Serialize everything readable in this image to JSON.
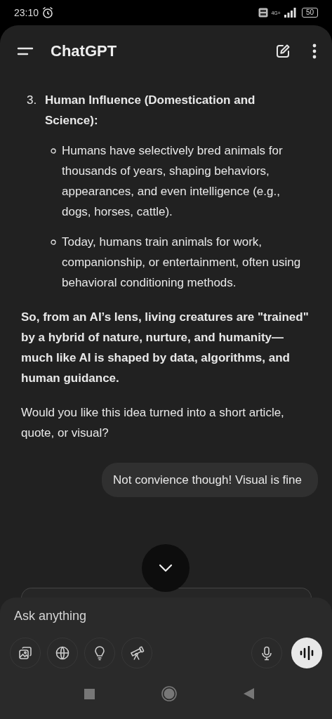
{
  "status_bar": {
    "time": "23:10",
    "network": "4G+",
    "battery": "50"
  },
  "header": {
    "title": "ChatGPT"
  },
  "assistant_message": {
    "list_item": {
      "number": "3.",
      "title": "Human Influence (Domestication and Science):",
      "bullets": [
        "Humans have selectively bred animals for thousands of years, shaping behaviors, appearances, and even intelligence (e.g., dogs, horses, cattle).",
        "Today, humans train animals for work, companionship, or entertainment, often using behavioral conditioning methods."
      ]
    },
    "summary": "So, from an AI’s lens, living creatures are \"trained\" by a hybrid of nature, nurture, and humanity—much like AI is shaped by data, algorithms, and human guidance.",
    "question": "Would you like this idea turned into a short article, quote, or visual?"
  },
  "user_message": "Not convience though! Visual is fine",
  "composer": {
    "placeholder": "Ask anything",
    "tools": [
      {
        "kind": "image"
      },
      {
        "kind": "globe"
      },
      {
        "kind": "bulb"
      },
      {
        "kind": "telescope"
      }
    ]
  }
}
